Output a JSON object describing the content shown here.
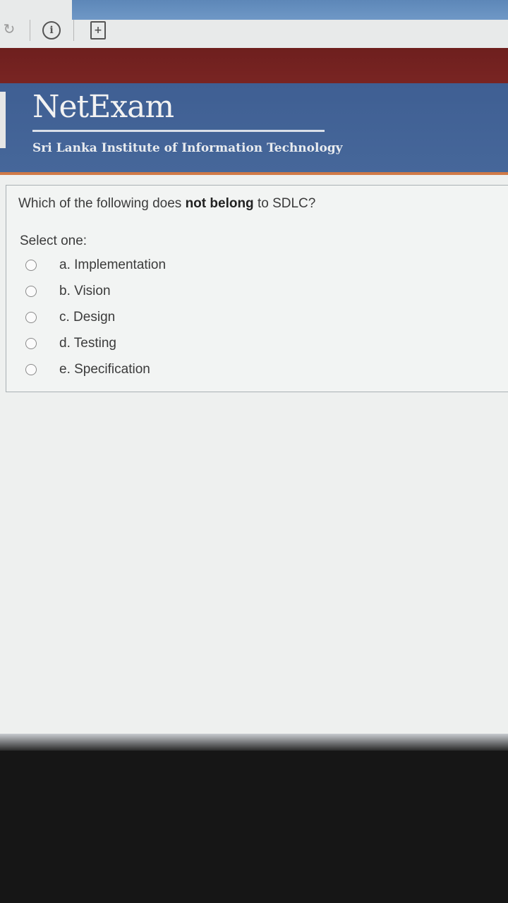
{
  "toolbar": {
    "icons": [
      "reload-icon",
      "info-icon",
      "add-page-icon"
    ],
    "info_glyph": "i",
    "add_glyph": "+",
    "reload_glyph": "↻"
  },
  "header": {
    "brand": "NetExam",
    "subtitle": "Sri Lanka Institute of Information Technology"
  },
  "question": {
    "text_before": "Which of the following does ",
    "text_bold": "not belong",
    "text_after": " to SDLC?",
    "prompt": "Select one:",
    "options": [
      {
        "label": "a. Implementation",
        "selected": false
      },
      {
        "label": "b. Vision",
        "selected": false
      },
      {
        "label": "c. Design",
        "selected": false
      },
      {
        "label": "d. Testing",
        "selected": false
      },
      {
        "label": "e. Specification",
        "selected": false
      }
    ]
  },
  "colors": {
    "maroon": "#6e1f1e",
    "header_blue": "#3f5f93",
    "accent_orange": "#d07a47"
  }
}
